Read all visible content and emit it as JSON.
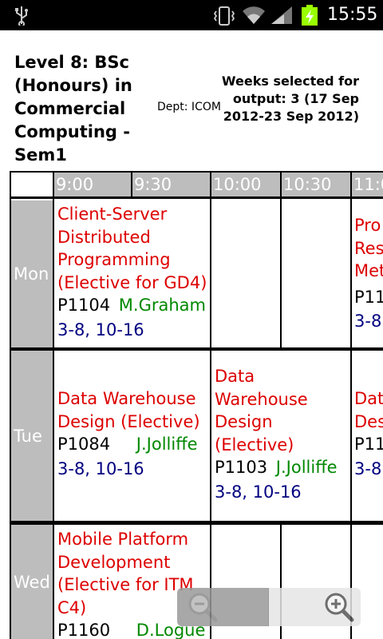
{
  "status_bar": {
    "time": "15:55",
    "icons": [
      "usb-icon",
      "vibrate-icon",
      "wifi-icon",
      "signal-icon",
      "battery-charging-icon"
    ]
  },
  "header": {
    "title": "Level 8: BSc (Honours) in Commercial Computing - Sem1",
    "dept": "Dept: ICOM",
    "weeks": "Weeks selected for output: 3 (17 Sep 2012-23 Sep 2012)"
  },
  "timetable": {
    "times": [
      "9:00",
      "9:30",
      "10:00",
      "10:30",
      "11:0"
    ],
    "days": [
      "Mon",
      "Tue",
      "Wed"
    ],
    "entries": {
      "mon_1": {
        "module": "Client-Server Distributed Programming (Elective for GD4)",
        "room": "P1104",
        "lecturer": "M.Graham",
        "weeks": "3-8, 10-16"
      },
      "mon_2": {
        "module": "Pro Res Met",
        "room": "P11",
        "weeks": "3-8"
      },
      "tue_1": {
        "module": "Data Warehouse Design (Elective)",
        "room": "P1084",
        "lecturer": "J.Jolliffe",
        "weeks": "3-8, 10-16"
      },
      "tue_2": {
        "module": "Data Warehouse Design (Elective)",
        "room": "P1103",
        "lecturer": "J.Jolliffe",
        "weeks": "3-8, 10-16"
      },
      "tue_3": {
        "module": "Dat Des",
        "room": "P11",
        "weeks": "3-8"
      },
      "wed_1": {
        "module": "Mobile Platform Development (Elective for ITM C4)",
        "room": "P1160",
        "lecturer": "D.Logue"
      }
    }
  },
  "zoom_controls": [
    "zoom-out-icon",
    "zoom-in-icon"
  ]
}
